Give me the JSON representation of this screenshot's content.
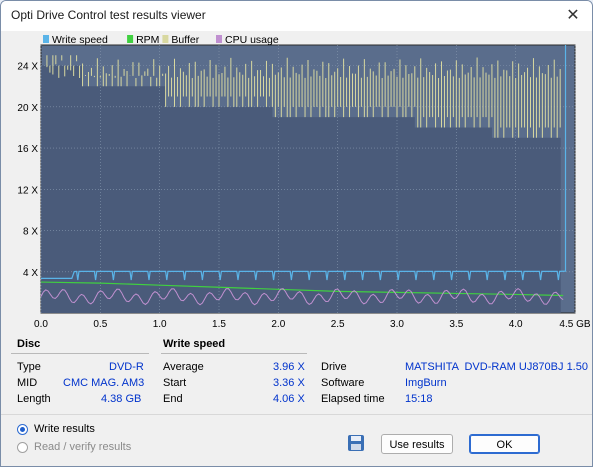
{
  "window": {
    "title": "Opti Drive Control test results viewer"
  },
  "chart_data": {
    "type": "line",
    "legend": [
      "Write speed",
      "RPM",
      "Buffer",
      "CPU usage"
    ],
    "legend_placement": "top-left",
    "colors": {
      "Write speed": "#5ab4e8",
      "RPM": "#40d040",
      "Buffer": "#d8d8a0",
      "CPU usage": "#c090d0",
      "plot_bg": "#5a6d8c",
      "lower_bg": "#4a5b7a"
    },
    "x_ticks": [
      "0.0",
      "0.5",
      "1.0",
      "1.5",
      "2.0",
      "2.5",
      "3.0",
      "3.5",
      "4.0",
      "4.5 GB"
    ],
    "y_ticks": [
      "4 X",
      "8 X",
      "12 X",
      "16 X",
      "20 X",
      "24 X"
    ],
    "xlim": [
      0,
      4.5
    ],
    "ylim": [
      0,
      26
    ],
    "grid": true,
    "series": [
      {
        "name": "Write speed",
        "x": [
          0.0,
          0.25,
          0.3,
          4.4,
          4.42
        ],
        "y": [
          3.36,
          3.36,
          4.0,
          4.06,
          26
        ]
      },
      {
        "name": "RPM",
        "x": [
          0.0,
          0.5,
          1.0,
          1.5,
          2.0,
          2.5,
          3.0,
          3.5,
          4.0,
          4.4
        ],
        "y": [
          3.0,
          2.9,
          2.7,
          2.5,
          2.3,
          2.1,
          2.0,
          1.9,
          1.8,
          1.7
        ]
      },
      {
        "name": "Buffer",
        "x": [
          0.0,
          0.35,
          1.05,
          1.95,
          3.15,
          3.8,
          4.38
        ],
        "y": [
          24,
          22,
          20,
          19,
          18,
          17,
          15
        ]
      },
      {
        "name": "CPU usage",
        "x": [
          0.0,
          0.5,
          1.0,
          1.5,
          2.0,
          2.5,
          3.0,
          3.5,
          4.0,
          4.4
        ],
        "y": [
          1.6,
          1.8,
          1.5,
          1.4,
          1.6,
          1.5,
          1.6,
          1.5,
          1.7,
          1.6
        ]
      }
    ],
    "disc_level_steps": {
      "x": [
        0.0,
        0.35,
        1.05,
        1.95,
        3.15,
        3.8,
        4.38
      ],
      "y": [
        24,
        22,
        20,
        19,
        18,
        17,
        15
      ]
    }
  },
  "disc": {
    "header": "Disc",
    "rows": [
      {
        "label": "Type",
        "value": "DVD-R"
      },
      {
        "label": "MID",
        "value": "CMC MAG. AM3"
      },
      {
        "label": "Length",
        "value": "4.38 GB"
      }
    ]
  },
  "write_speed": {
    "header": "Write speed",
    "rows": [
      {
        "label": "Average",
        "value": "3.96 X"
      },
      {
        "label": "Start",
        "value": "3.36 X"
      },
      {
        "label": "End",
        "value": "4.06 X"
      }
    ]
  },
  "drive_info": {
    "rows": [
      {
        "label": "Drive",
        "value": "MATSHITA  DVD-RAM UJ870BJ 1.50"
      },
      {
        "label": "Software",
        "value": "ImgBurn"
      },
      {
        "label": "Elapsed time",
        "value": "15:18"
      }
    ]
  },
  "options": {
    "write_results": "Write results",
    "read_verify": "Read / verify results"
  },
  "buttons": {
    "use_results": "Use results",
    "ok": "OK"
  },
  "icons": {
    "save": "floppy-disk-icon",
    "close": "close-icon"
  }
}
